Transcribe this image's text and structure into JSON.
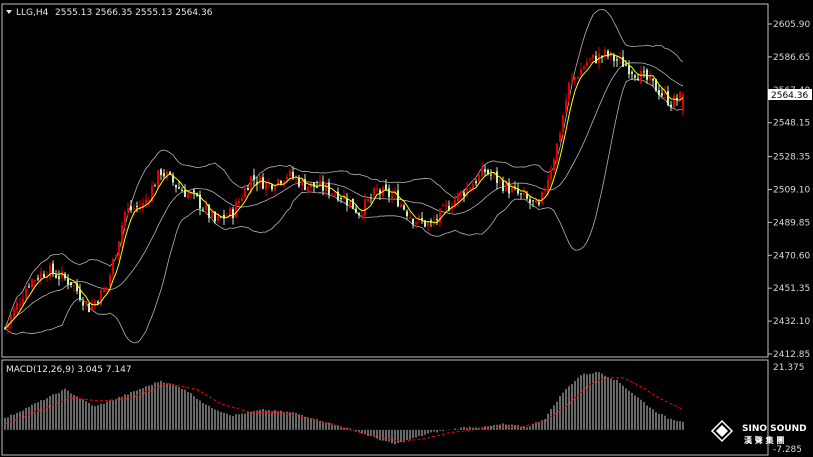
{
  "header": {
    "symbol": "LLG,H4",
    "ohlc": "2555.13 2566.35 2555.13 2564.36"
  },
  "macd": {
    "label": "MACD(12,26,9) 3.045 7.147",
    "axis_top": "21.375",
    "axis_bottom": "-7.285"
  },
  "logo": {
    "brand": "SINO SOUND",
    "sub": "漢 聲 集 團"
  },
  "colors": {
    "background": "#000000",
    "bull_candle": "#e00000",
    "bear_candle": "#c8f0c0",
    "bollinger": "#b4b4b4",
    "moving_average": "#ffff00",
    "macd_histogram": "#d0d0d0",
    "macd_signal": "#ff0000",
    "current_price_tag": "#ffffff"
  },
  "chart_data": [
    {
      "type": "candlestick",
      "title": "LLG,H4",
      "ylim": [
        2412.85,
        2605.9
      ],
      "y_ticks": [
        "2605.90",
        "2586.65",
        "2567.40",
        "2548.15",
        "2528.35",
        "2509.10",
        "2489.85",
        "2470.60",
        "2451.35",
        "2432.10",
        "2412.85"
      ],
      "current_price": "2564.36",
      "overlays": [
        "Bollinger Bands",
        "Moving Average"
      ],
      "close_path": [
        [
          0,
          2428
        ],
        [
          8,
          2455
        ],
        [
          14,
          2462
        ],
        [
          22,
          2455
        ],
        [
          28,
          2440
        ],
        [
          34,
          2452
        ],
        [
          40,
          2496
        ],
        [
          46,
          2500
        ],
        [
          52,
          2520
        ],
        [
          58,
          2510
        ],
        [
          64,
          2503
        ],
        [
          70,
          2490
        ],
        [
          76,
          2496
        ],
        [
          82,
          2516
        ],
        [
          88,
          2512
        ],
        [
          94,
          2518
        ],
        [
          100,
          2512
        ],
        [
          106,
          2510
        ],
        [
          112,
          2506
        ],
        [
          118,
          2496
        ],
        [
          124,
          2508
        ],
        [
          130,
          2505
        ],
        [
          136,
          2492
        ],
        [
          142,
          2488
        ],
        [
          148,
          2500
        ],
        [
          154,
          2510
        ],
        [
          160,
          2520
        ],
        [
          166,
          2512
        ],
        [
          172,
          2505
        ],
        [
          178,
          2498
        ],
        [
          184,
          2535
        ],
        [
          188,
          2570
        ],
        [
          194,
          2584
        ],
        [
          200,
          2588
        ],
        [
          206,
          2583
        ],
        [
          210,
          2578
        ],
        [
          214,
          2573
        ],
        [
          218,
          2567
        ],
        [
          222,
          2560
        ],
        [
          226,
          2564
        ]
      ]
    },
    {
      "type": "macd",
      "title": "MACD(12,26,9) 3.045 7.147",
      "ylim": [
        -7.285,
        21.375
      ],
      "histogram_path": [
        [
          0,
          4
        ],
        [
          10,
          9
        ],
        [
          20,
          14
        ],
        [
          30,
          8
        ],
        [
          40,
          12
        ],
        [
          52,
          17
        ],
        [
          60,
          14
        ],
        [
          68,
          8
        ],
        [
          76,
          5
        ],
        [
          86,
          7
        ],
        [
          96,
          6
        ],
        [
          106,
          3
        ],
        [
          116,
          0
        ],
        [
          124,
          -3
        ],
        [
          130,
          -5
        ],
        [
          136,
          -3
        ],
        [
          142,
          -1
        ],
        [
          148,
          0
        ],
        [
          154,
          1
        ],
        [
          160,
          1
        ],
        [
          166,
          2
        ],
        [
          174,
          1
        ],
        [
          180,
          4
        ],
        [
          186,
          13
        ],
        [
          192,
          19
        ],
        [
          198,
          20
        ],
        [
          204,
          17
        ],
        [
          210,
          12
        ],
        [
          216,
          7
        ],
        [
          221,
          4
        ],
        [
          226,
          3
        ]
      ],
      "signal_path": [
        [
          0,
          2
        ],
        [
          12,
          7
        ],
        [
          22,
          11
        ],
        [
          32,
          10
        ],
        [
          42,
          11
        ],
        [
          54,
          16
        ],
        [
          64,
          14
        ],
        [
          72,
          9
        ],
        [
          82,
          6
        ],
        [
          92,
          6
        ],
        [
          102,
          4
        ],
        [
          112,
          1
        ],
        [
          122,
          -2
        ],
        [
          132,
          -4
        ],
        [
          140,
          -3
        ],
        [
          148,
          -1
        ],
        [
          156,
          0
        ],
        [
          164,
          1
        ],
        [
          172,
          1
        ],
        [
          180,
          3
        ],
        [
          188,
          9
        ],
        [
          194,
          15
        ],
        [
          200,
          18
        ],
        [
          206,
          18
        ],
        [
          212,
          15
        ],
        [
          218,
          11
        ],
        [
          224,
          8
        ],
        [
          226,
          7
        ]
      ]
    }
  ]
}
